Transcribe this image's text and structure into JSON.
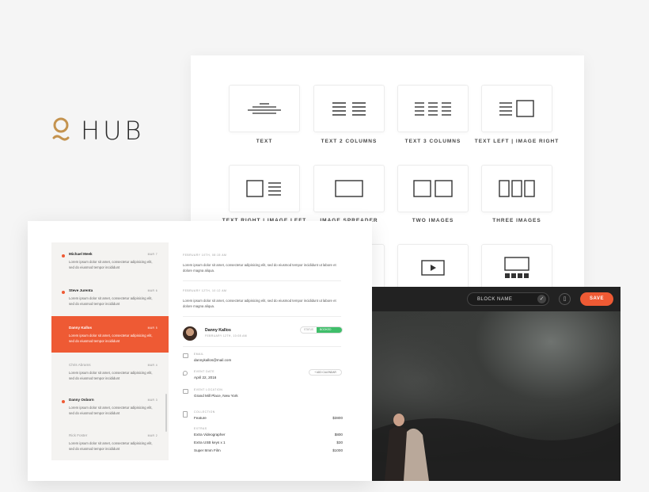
{
  "logo": {
    "text": "HUB",
    "color": "#c4934f"
  },
  "gallery": {
    "tiles": [
      {
        "label": "TEXT",
        "icon": "text-block-icon"
      },
      {
        "label": "TEXT 2 COLUMNS",
        "icon": "two-columns-icon"
      },
      {
        "label": "TEXT 3 COLUMNS",
        "icon": "three-columns-icon"
      },
      {
        "label": "TEXT LEFT | IMAGE RIGHT",
        "icon": "text-left-image-right-icon"
      },
      {
        "label": "TEXT RIGHT | IMAGE LEFT",
        "icon": "image-left-text-right-icon"
      },
      {
        "label": "IMAGE SPREADER",
        "icon": "image-spreader-icon"
      },
      {
        "label": "TWO IMAGES",
        "icon": "two-images-icon"
      },
      {
        "label": "THREE IMAGES",
        "icon": "three-images-icon"
      },
      {
        "label": "",
        "icon": "video-block-icon"
      },
      {
        "label": "",
        "icon": "gallery-block-icon"
      }
    ]
  },
  "inbox": {
    "items": [
      {
        "name": "Michael Meek",
        "date": "MAR 7",
        "preview": "Lorem ipsum dolor sit amet, consectetur adipisicing elit, sed do eiusmod tempor incididunt",
        "state": "unread"
      },
      {
        "name": "Steve Jurenta",
        "date": "MAR 6",
        "preview": "Lorem ipsum dolor sit amet, consectetur adipisicing elit, sed do eiusmod tempor incididunt",
        "state": "unread"
      },
      {
        "name": "Danny Kallos",
        "date": "MAR 5",
        "preview": "Lorem ipsum dolor sit amet, consectetur adipisicing elit, sed do eiusmod tempor incididunt",
        "state": "selected"
      },
      {
        "name": "Chris Abrams",
        "date": "MAR 4",
        "preview": "Lorem ipsum dolor sit amet, consectetur adipisicing elit, sed do eiusmod tempor incididunt",
        "state": "read"
      },
      {
        "name": "Danny Osborn",
        "date": "MAR 3",
        "preview": "Lorem ipsum dolor sit amet, consectetur adipisicing elit, sed do eiusmod tempor incididunt",
        "state": "unread"
      },
      {
        "name": "Rick Foster",
        "date": "MAR 2",
        "preview": "Lorem ipsum dolor sit amet, consectetur adipisicing elit, sed do eiusmod tempor incididunt",
        "state": "read"
      }
    ],
    "messages": [
      {
        "date": "FEBRUARY 10TH, 08:15 AM",
        "text": "Lorem ipsum dolor sit amet, consectetur adipisicing elit, sed do eiusmod tempor incididunt ut labore et dolore magna aliqua."
      },
      {
        "date": "FEBRUARY 12TH, 10:12 AM",
        "text": "Lorem ipsum dolor sit amet, consectetur adipisicing elit, sed do eiusmod tempor incididunt ut labore et dolore magna aliqua."
      }
    ],
    "contact": {
      "name": "Danny Kallos",
      "subtitle": "FEBRUARY 12TH, 10:08 AM",
      "status_label": "STATUS",
      "status_value": "BOOKED",
      "status_color": "#3fbe6a",
      "email_label": "EMAIL",
      "email": "dannykallos@mail.com",
      "event_date_label": "EVENT DATE",
      "event_date": "April 22, 2016",
      "add_calendar": "+ ADD CALENDAR",
      "location_label": "EVENT LOCATION",
      "location": "Grand Mill Place, New York",
      "collection_label": "COLLECTION",
      "collection": {
        "name": "Feature",
        "price": "$3800"
      },
      "extras_label": "EXTRAS",
      "extras": [
        {
          "name": "Extra Videographer",
          "price": "$800"
        },
        {
          "name": "Extra USB keys",
          "qty": "x 1",
          "price": "$30"
        },
        {
          "name": "Super 8mm Film",
          "price": "$1000"
        }
      ]
    }
  },
  "editor": {
    "block_name_placeholder": "BLOCK NAME",
    "save_label": "SAVE",
    "accent": "#ee5a34"
  }
}
